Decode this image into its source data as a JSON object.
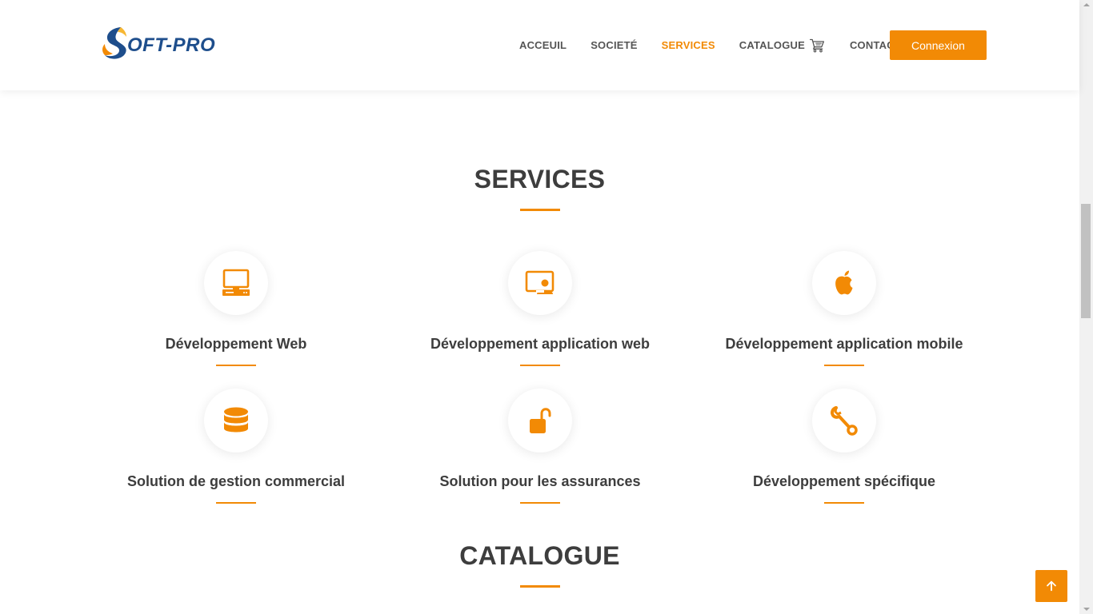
{
  "brand": {
    "logo_text": "OFT-PRO",
    "accent_color": "#f28a05",
    "logo_blue": "#1e4e8c"
  },
  "nav": {
    "items": [
      {
        "label": "ACCEUIL"
      },
      {
        "label": "SOCIETÉ"
      },
      {
        "label": "SERVICES",
        "active": true
      },
      {
        "label": "CATALOGUE",
        "icon": "cart-icon"
      },
      {
        "label": "CONTACT"
      }
    ],
    "login_label": "Connexion"
  },
  "services": {
    "title": "SERVICES",
    "items": [
      {
        "title": "Développement Web",
        "icon": "desktop-computer-icon"
      },
      {
        "title": "Développement application web",
        "icon": "screen-user-icon"
      },
      {
        "title": "Développement application mobile",
        "icon": "apple-icon"
      },
      {
        "title": "Solution de gestion commercial",
        "icon": "database-icon"
      },
      {
        "title": "Solution pour les assurances",
        "icon": "unlock-icon"
      },
      {
        "title": "Développement spécifique",
        "icon": "wrench-icon"
      }
    ]
  },
  "catalogue": {
    "title": "CATALOGUE"
  },
  "back_to_top": {
    "icon": "arrow-up-icon"
  }
}
